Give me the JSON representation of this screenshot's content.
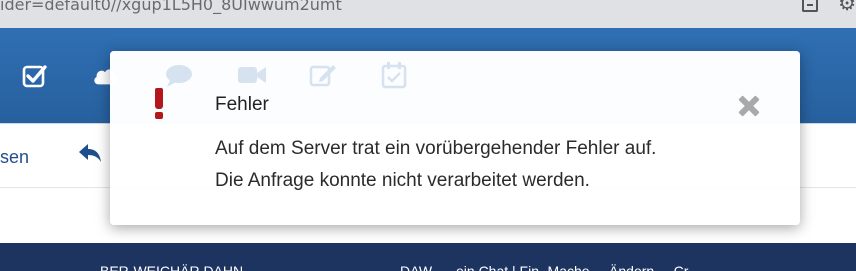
{
  "browser": {
    "url_fragment": "ider=default0//xgup1L5H0_8UIwwum2umt"
  },
  "toolbar": {
    "partial_label": "sen"
  },
  "navbar": {
    "left_text": "BER-WEICHÄR DAHN",
    "right_text": "DAW- ... ein Chat | Fin- Mache ... Ändern ... Cr"
  },
  "dialog": {
    "title": "Fehler",
    "message_line1": "Auf dem Server trat ein vorübergehender Fehler auf.",
    "message_line2": "Die Anfrage konnte nicht verarbeitet werden.",
    "error_color": "#b3161b"
  },
  "colors": {
    "header_blue": "#2f6fb3",
    "nav_navy": "#1d3461",
    "link_blue": "#1f4e8c"
  },
  "icons": [
    "checkbox-icon",
    "cloud-icon",
    "chat-icon",
    "video-icon",
    "edit-icon",
    "calendar-check-icon",
    "reply-icon",
    "error-icon",
    "close-icon",
    "extension-icon",
    "settings-icon"
  ]
}
